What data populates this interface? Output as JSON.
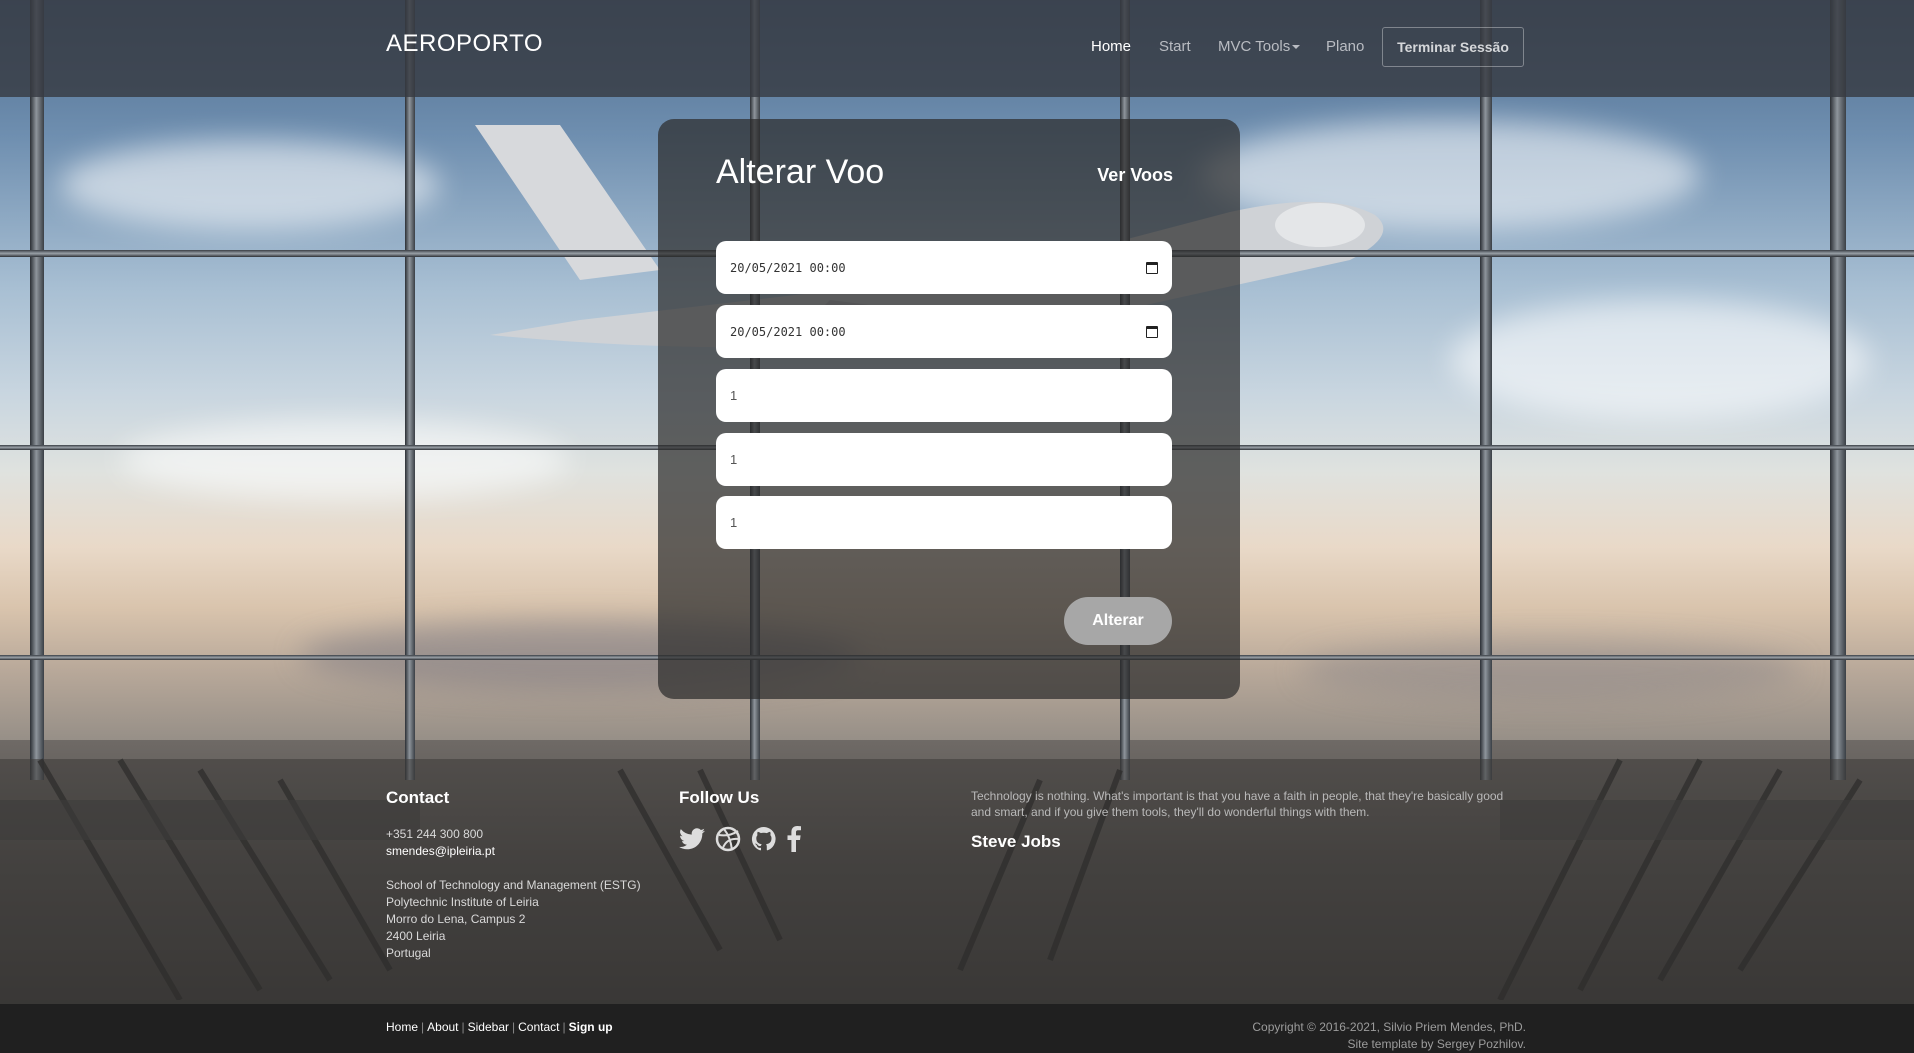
{
  "header": {
    "brand": "AEROPORTO",
    "nav": [
      "Home",
      "Start",
      "MVC Tools",
      "Plano"
    ],
    "logout_label": "Terminar Sessão"
  },
  "form": {
    "title": "Alterar Voo",
    "link_label": "Ver Voos",
    "fields": {
      "date1": "20/05/2021 00:00",
      "date2": "20/05/2021 00:00",
      "num1": "1",
      "num2": "1",
      "num3": "1"
    },
    "submit_label": "Alterar"
  },
  "footer": {
    "contact": {
      "heading": "Contact",
      "phone": "+351 244 300 800",
      "email": "smendes@ipleiria.pt",
      "address": [
        "School of Technology and Management (ESTG)",
        "Polytechnic Institute of Leiria",
        "Morro do Lena, Campus 2",
        "2400 Leiria",
        "Portugal"
      ]
    },
    "follow": {
      "heading": "Follow Us",
      "icons": [
        "twitter-icon",
        "dribbble-icon",
        "github-icon",
        "facebook-icon"
      ]
    },
    "quote": {
      "text": "Technology is nothing. What's important is that you have a faith in people, that they're basically good and smart, and if you give them tools, they'll do wonderful things with them.",
      "author": "Steve Jobs"
    },
    "bottom_links": [
      "Home",
      "About",
      "Sidebar",
      "Contact",
      "Sign up"
    ],
    "copyright": "Copyright © 2016-2021, Silvio Priem Mendes, PhD.",
    "template_credit": "Site template by Sergey Pozhilov."
  },
  "colors": {
    "header_bg": "#373a42",
    "panel_bg": "#2d2d2d",
    "submit_bg": "#a7a7a7",
    "bottom_bar": "#202020"
  }
}
